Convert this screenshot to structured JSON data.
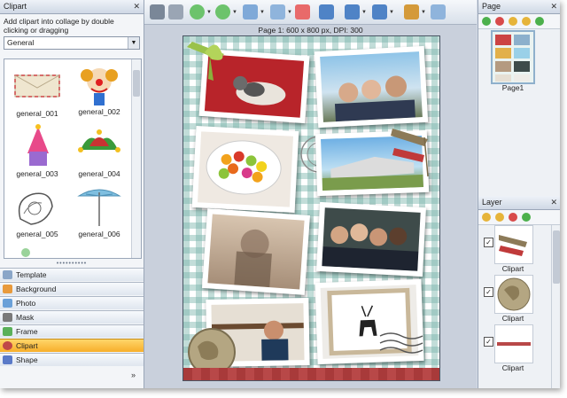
{
  "clipart_panel": {
    "title": "Clipart",
    "hint": "Add clipart into collage by double clicking or dragging",
    "category": "General",
    "items": [
      {
        "label": "general_001",
        "icon": "envelope-clipart-icon"
      },
      {
        "label": "general_002",
        "icon": "clown-clipart-icon"
      },
      {
        "label": "general_003",
        "icon": "party-hat-clipart-icon"
      },
      {
        "label": "general_004",
        "icon": "jester-hat-clipart-icon"
      },
      {
        "label": "general_005",
        "icon": "paisley-clipart-icon"
      },
      {
        "label": "general_006",
        "icon": "umbrella-clipart-icon"
      }
    ]
  },
  "nav": {
    "template": "Template",
    "background": "Background",
    "photo": "Photo",
    "mask": "Mask",
    "frame": "Frame",
    "clipart": "Clipart",
    "shape": "Shape",
    "active": "Clipart"
  },
  "canvas": {
    "page_info": "Page 1: 600 x 800 px, DPI: 300"
  },
  "page_panel": {
    "title": "Page",
    "page_label": "Page1"
  },
  "layer_panel": {
    "title": "Layer",
    "items": [
      {
        "label": "Clipart",
        "checked": true,
        "icon": "flag-ribbon-icon"
      },
      {
        "label": "Clipart",
        "checked": true,
        "icon": "world-map-stamp-icon"
      },
      {
        "label": "Clipart",
        "checked": true,
        "icon": "red-ribbon-icon"
      }
    ]
  },
  "colors": {
    "accent_active": "#f7ae2a",
    "gingham": "#78b4aa",
    "panel_bg": "#f3f5f8"
  }
}
